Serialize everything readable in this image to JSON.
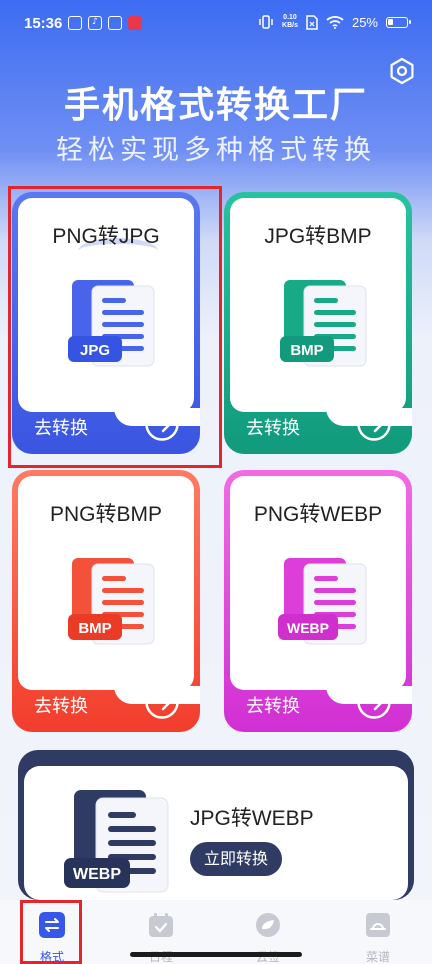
{
  "status_bar": {
    "time": "15:36",
    "net_speed_value": "0.10",
    "net_speed_unit": "KB/s",
    "battery": "25%"
  },
  "header": {
    "title": "手机格式转换工厂",
    "subtitle": "轻松实现多种格式转换",
    "settings_icon": "gear-icon"
  },
  "cards": [
    {
      "title": "PNG转JPG",
      "badge": "JPG",
      "action": "去转换",
      "color": "#4764ea"
    },
    {
      "title": "JPG转BMP",
      "badge": "BMP",
      "action": "去转换",
      "color": "#18a986"
    },
    {
      "title": "PNG转BMP",
      "badge": "BMP",
      "action": "去转换",
      "color": "#f4513b"
    },
    {
      "title": "PNG转WEBP",
      "badge": "WEBP",
      "action": "去转换",
      "color": "#dd3ed9"
    }
  ],
  "wide_card": {
    "title": "JPG转WEBP",
    "badge": "WEBP",
    "button": "立即转换",
    "color": "#2f3b62"
  },
  "bottom_nav": [
    {
      "label": "格式",
      "icon": "convert-icon",
      "active": true
    },
    {
      "label": "日程",
      "icon": "calendar-icon",
      "active": false
    },
    {
      "label": "云签",
      "icon": "cloud-icon",
      "active": false
    },
    {
      "label": "菜谱",
      "icon": "recipe-icon",
      "active": false
    }
  ],
  "colors": {
    "accent": "#3757e8",
    "highlight": "#e3262d"
  }
}
